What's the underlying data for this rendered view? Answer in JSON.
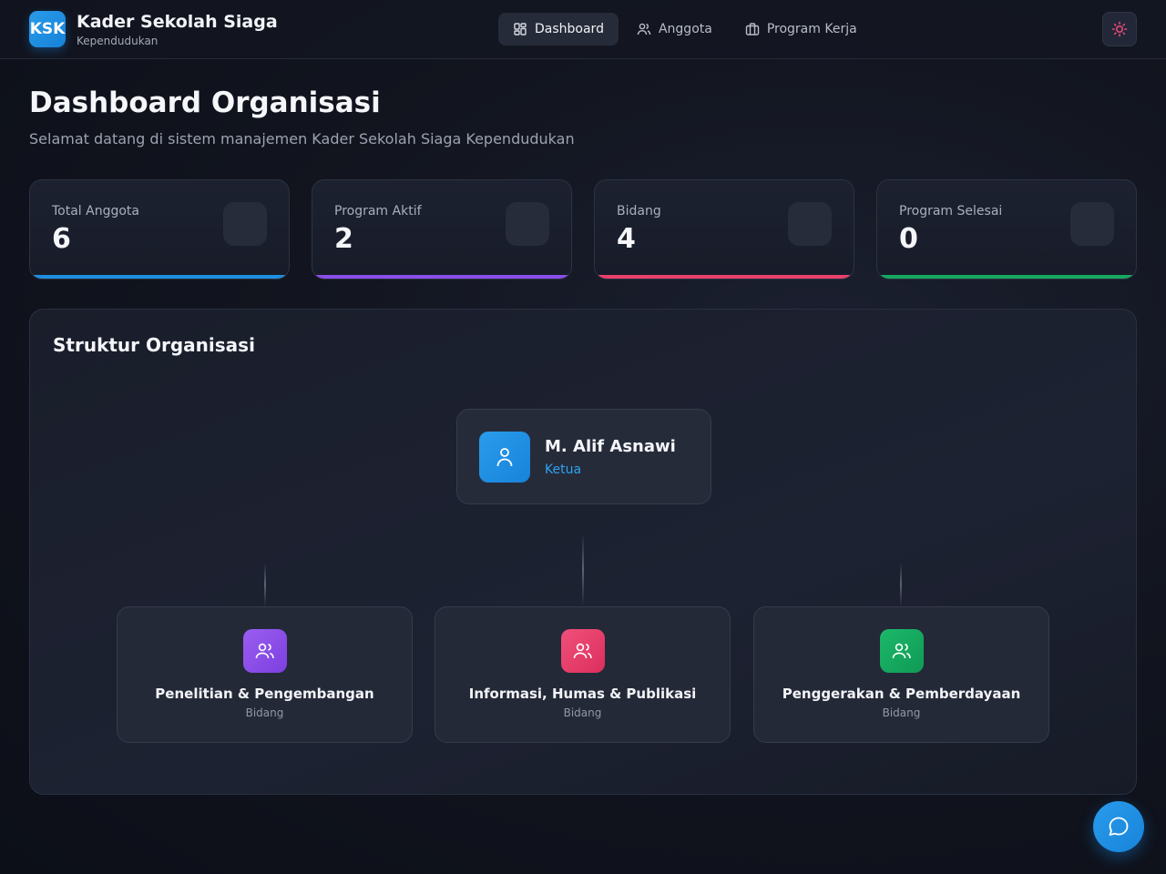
{
  "brand": {
    "logo": "KSK",
    "title": "Kader Sekolah Siaga",
    "subtitle": "Kependudukan"
  },
  "nav": {
    "items": [
      {
        "label": "Dashboard",
        "icon": "dashboard-grid-icon",
        "active": true
      },
      {
        "label": "Anggota",
        "icon": "users-icon",
        "active": false
      },
      {
        "label": "Program Kerja",
        "icon": "briefcase-icon",
        "active": false
      }
    ]
  },
  "theme_toggle": {
    "icon": "sun-icon",
    "color": "#e84a7a"
  },
  "page": {
    "title": "Dashboard Organisasi",
    "subtitle": "Selamat datang di sistem manajemen Kader Sekolah Siaga Kependudukan"
  },
  "stats": [
    {
      "label": "Total Anggota",
      "value": "6",
      "color": "#1e8fe0"
    },
    {
      "label": "Program Aktif",
      "value": "2",
      "color": "#8b4ee8"
    },
    {
      "label": "Bidang",
      "value": "4",
      "color": "#e8416c"
    },
    {
      "label": "Program Selesai",
      "value": "0",
      "color": "#16a861"
    }
  ],
  "org": {
    "title": "Struktur Organisasi",
    "leader": {
      "name": "M. Alif Asnawi",
      "role": "Ketua",
      "icon": "user-icon"
    },
    "departments": [
      {
        "name": "Penelitian & Pengembangan",
        "type": "Bidang",
        "color": "#8b4ee8",
        "icon": "users-icon"
      },
      {
        "name": "Informasi, Humas & Publikasi",
        "type": "Bidang",
        "color": "#e8416c",
        "icon": "users-icon"
      },
      {
        "name": "Penggerakan & Pemberdayaan",
        "type": "Bidang",
        "color": "#16a861",
        "icon": "users-icon"
      }
    ]
  },
  "chat": {
    "icon": "chat-bubble-icon"
  }
}
